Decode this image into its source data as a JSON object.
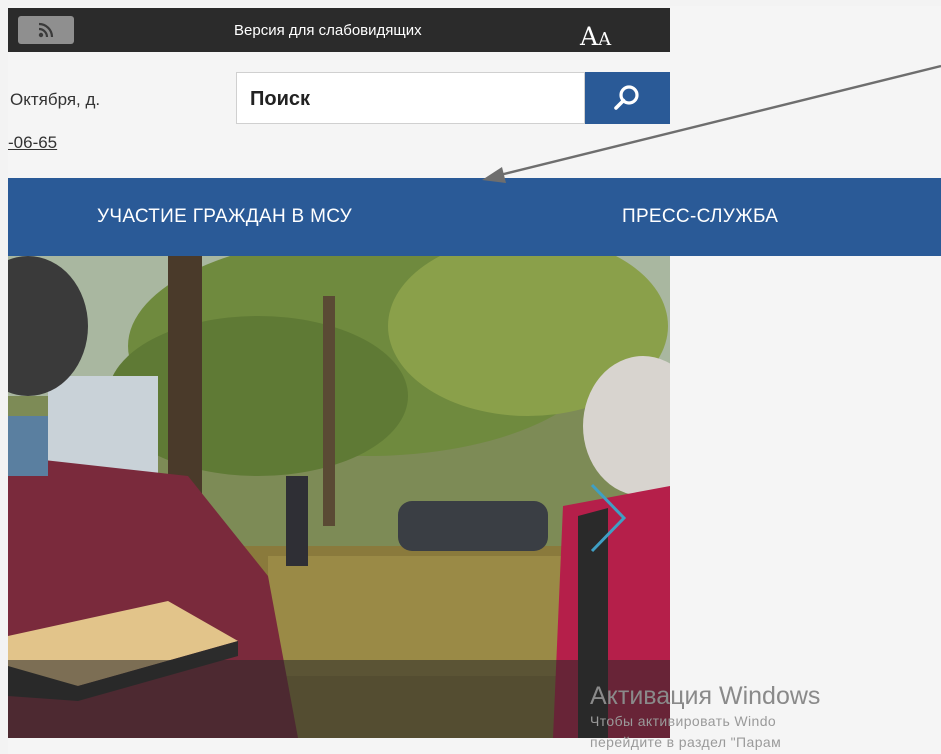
{
  "topbar": {
    "rss_icon": "rss-icon",
    "accessibility_link": "Версия для слабовидящих",
    "font_size_big": "A",
    "font_size_small": "A"
  },
  "header": {
    "address_fragment": "Октября, д.",
    "phone_fragment": "-06-65"
  },
  "search": {
    "placeholder": "Поиск",
    "button_icon": "search-icon"
  },
  "nav": {
    "items": [
      {
        "label": "УЧАСТИЕ ГРАЖДАН В МСУ"
      },
      {
        "label": "ПРЕСС-СЛУЖБА"
      }
    ]
  },
  "hero": {
    "next_icon": "chevron-right-icon"
  },
  "watermark": {
    "title": "Активация Windows",
    "line1": "Чтобы активировать Windo",
    "line2": "перейдите в раздел \"Парам"
  },
  "colors": {
    "nav_blue": "#2a5a97",
    "topbar_dark": "#2b2b2b",
    "arrow_gray": "#6e6e6e",
    "slider_arrow": "#3f9fc4"
  }
}
